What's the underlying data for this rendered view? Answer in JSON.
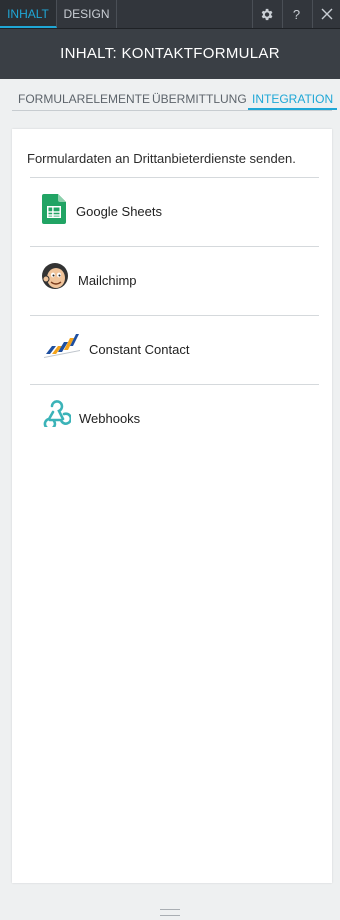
{
  "top_tabs": [
    {
      "label": "INHALT",
      "active": true
    },
    {
      "label": "DESIGN",
      "active": false
    }
  ],
  "top_icons": [
    "gear-icon",
    "help-icon",
    "close-icon"
  ],
  "help_glyph": "?",
  "title": "INHALT: KONTAKTFORMULAR",
  "sub_tabs": [
    {
      "label": "FORMULARELEMENTE",
      "active": false
    },
    {
      "label": "ÜBERMITTLUNG",
      "active": false
    },
    {
      "label": "INTEGRATION",
      "active": true
    }
  ],
  "intro": "Formulardaten an Drittanbieterdienste senden.",
  "integrations": [
    {
      "label": "Google Sheets",
      "icon": "google-sheets-icon"
    },
    {
      "label": "Mailchimp",
      "icon": "mailchimp-icon"
    },
    {
      "label": "Constant Contact",
      "icon": "constant-contact-icon"
    },
    {
      "label": "Webhooks",
      "icon": "webhooks-icon"
    }
  ],
  "colors": {
    "accent": "#1fa7d6",
    "topbar": "#32363c",
    "title_bar": "#3a3f45",
    "background": "#eef0f1"
  }
}
